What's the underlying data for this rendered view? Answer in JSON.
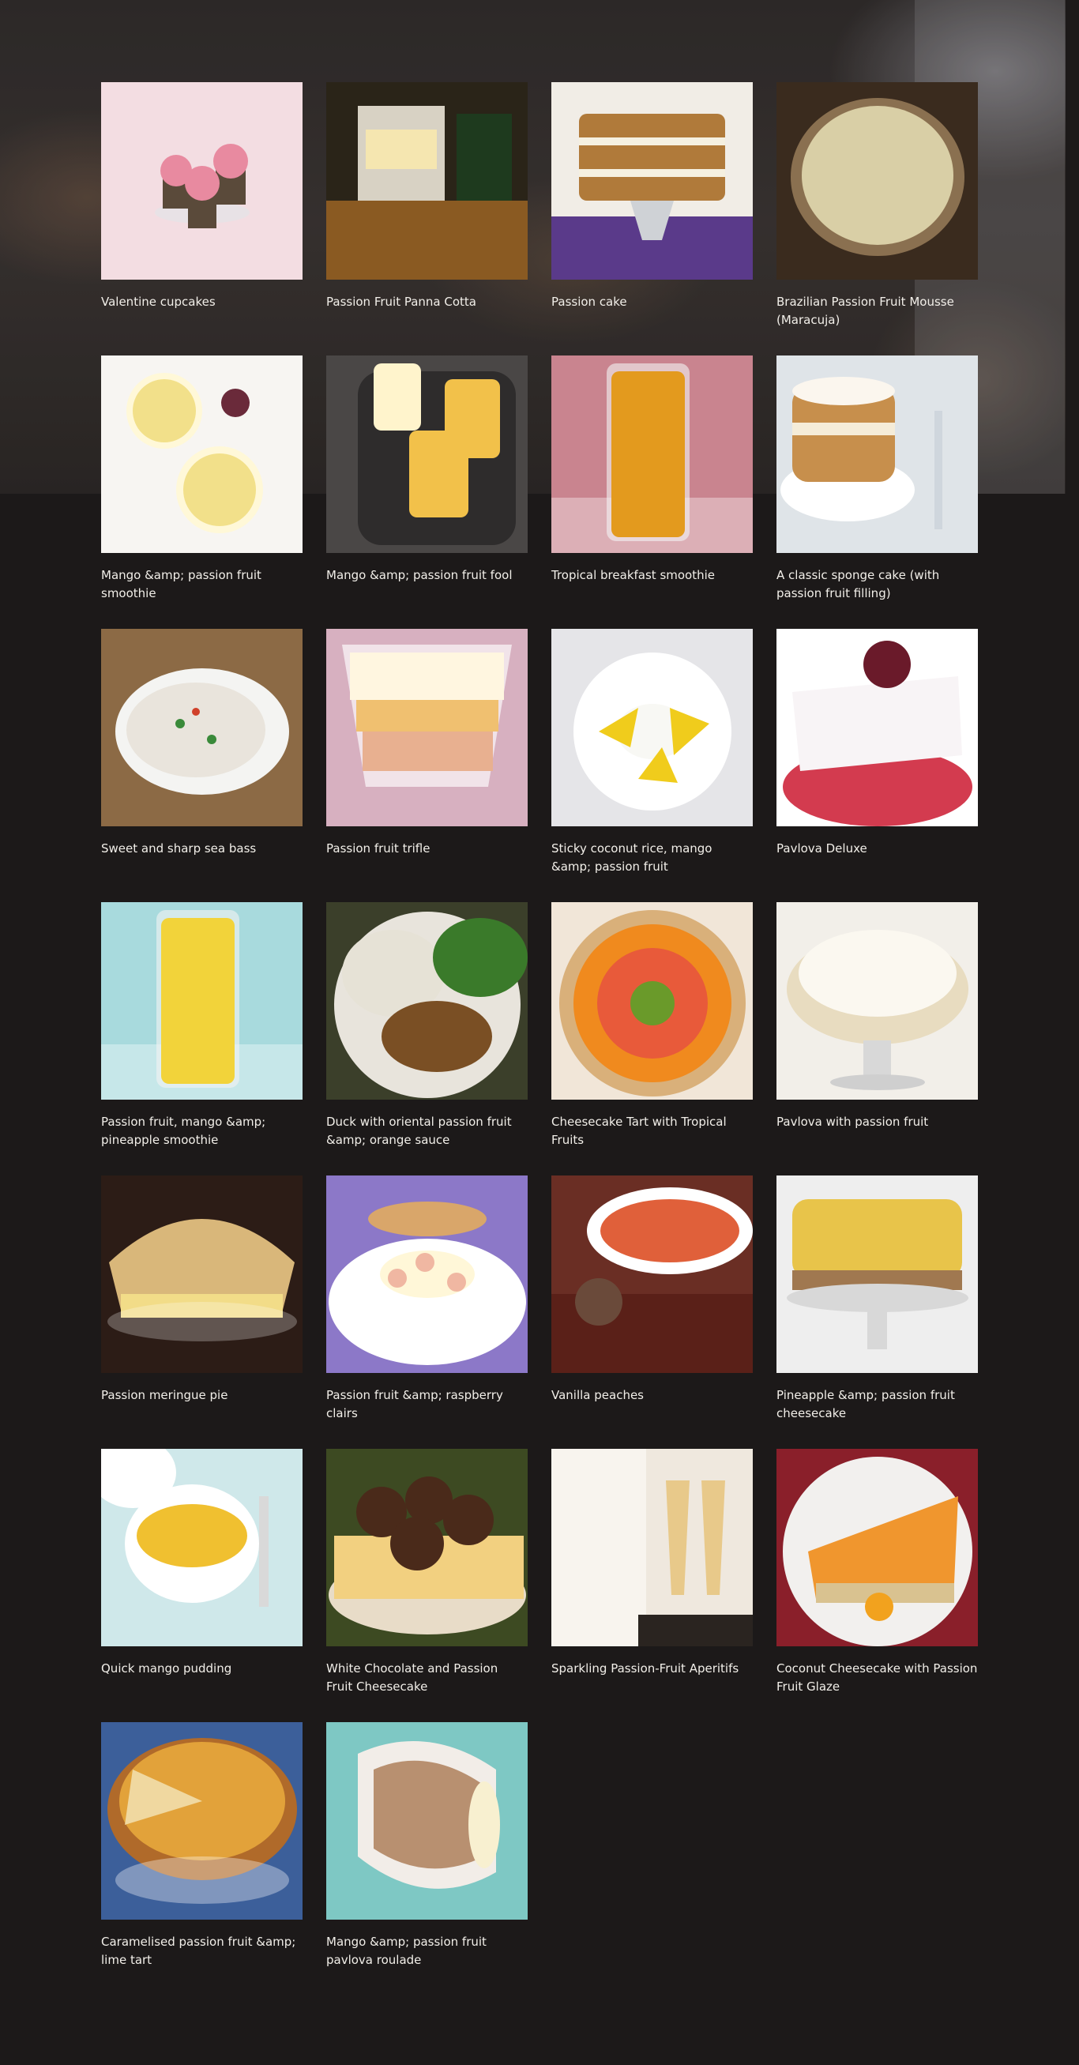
{
  "recipes": [
    {
      "title": "Valentine cupcakes",
      "bg": "#f3dde2",
      "accent": "#e88aa0",
      "shape": "cupcake"
    },
    {
      "title": "Passion Fruit Panna Cotta",
      "bg": "#2a2418",
      "accent": "#c98a3a",
      "shape": "street"
    },
    {
      "title": "Passion cake",
      "bg": "#f1ede6",
      "accent": "#b07a3a",
      "shape": "cake"
    },
    {
      "title": "Brazilian Passion Fruit Mousse (Maracuja)",
      "bg": "#3a2b1e",
      "accent": "#d9cfa6",
      "shape": "bowl"
    },
    {
      "title": "Mango &amp; passion fruit smoothie",
      "bg": "#f7f5f2",
      "accent": "#f2e08a",
      "shape": "glasses-top"
    },
    {
      "title": "Mango &amp; passion fruit fool",
      "bg": "#4a4746",
      "accent": "#f2c14a",
      "shape": "glasses"
    },
    {
      "title": "Tropical breakfast smoothie",
      "bg": "#c9848f",
      "accent": "#e39a1e",
      "shape": "tall-glass"
    },
    {
      "title": "A classic sponge cake (with passion fruit filling)",
      "bg": "#dfe4e8",
      "accent": "#c78f4c",
      "shape": "sponge"
    },
    {
      "title": "Sweet and sharp sea bass",
      "bg": "#8c6a45",
      "accent": "#e9e4dc",
      "shape": "platter"
    },
    {
      "title": "Passion fruit trifle",
      "bg": "#d7b0c0",
      "accent": "#f0c070",
      "shape": "trifle"
    },
    {
      "title": "Sticky coconut rice, mango &amp; passion fruit",
      "bg": "#e5e5e8",
      "accent": "#f0cc1c",
      "shape": "plate"
    },
    {
      "title": "Pavlova Deluxe",
      "bg": "#ffffff",
      "accent": "#d33b4f",
      "shape": "pavlova-slice"
    },
    {
      "title": "Passion fruit, mango &amp; pineapple smoothie",
      "bg": "#a8dadd",
      "accent": "#f2d33a",
      "shape": "tall-glass"
    },
    {
      "title": "Duck with oriental passion fruit &amp; orange sauce",
      "bg": "#3b3f2a",
      "accent": "#7a4f24",
      "shape": "duck"
    },
    {
      "title": "Cheesecake Tart with Tropical Fruits",
      "bg": "#f1e6d8",
      "accent": "#f08a1e",
      "shape": "tart"
    },
    {
      "title": "Pavlova with passion fruit",
      "bg": "#f2efe9",
      "accent": "#e8dcc0",
      "shape": "pavlova"
    },
    {
      "title": "Passion meringue pie",
      "bg": "#2c1c16",
      "accent": "#d9b77a",
      "shape": "meringue"
    },
    {
      "title": "Passion fruit &amp; raspberry clairs",
      "bg": "#8c78c8",
      "accent": "#cc2a4a",
      "shape": "eclair"
    },
    {
      "title": "Vanilla peaches",
      "bg": "#6a2e24",
      "accent": "#e0603a",
      "shape": "peaches"
    },
    {
      "title": "Pineapple &amp; passion fruit cheesecake",
      "bg": "#eeeeee",
      "accent": "#e8c44a",
      "shape": "cheesecake"
    },
    {
      "title": "Quick mango pudding",
      "bg": "#cfe8ea",
      "accent": "#f0c030",
      "shape": "pudding"
    },
    {
      "title": "White Chocolate and Passion Fruit Cheesecake",
      "bg": "#3d4a22",
      "accent": "#4a2a1a",
      "shape": "choc-cake"
    },
    {
      "title": "Sparkling Passion-Fruit Aperitifs",
      "bg": "#efe8de",
      "accent": "#e8c98a",
      "shape": "flutes"
    },
    {
      "title": "Coconut Cheesecake with Passion Fruit Glaze",
      "bg": "#8a1f2a",
      "accent": "#f0962e",
      "shape": "glaze"
    },
    {
      "title": "Caramelised passion fruit &amp; lime tart",
      "bg": "#3c5f9a",
      "accent": "#e2a23a",
      "shape": "lime-tart"
    },
    {
      "title": "Mango &amp; passion fruit pavlova roulade",
      "bg": "#7ec8c4",
      "accent": "#b89070",
      "shape": "roulade"
    }
  ]
}
